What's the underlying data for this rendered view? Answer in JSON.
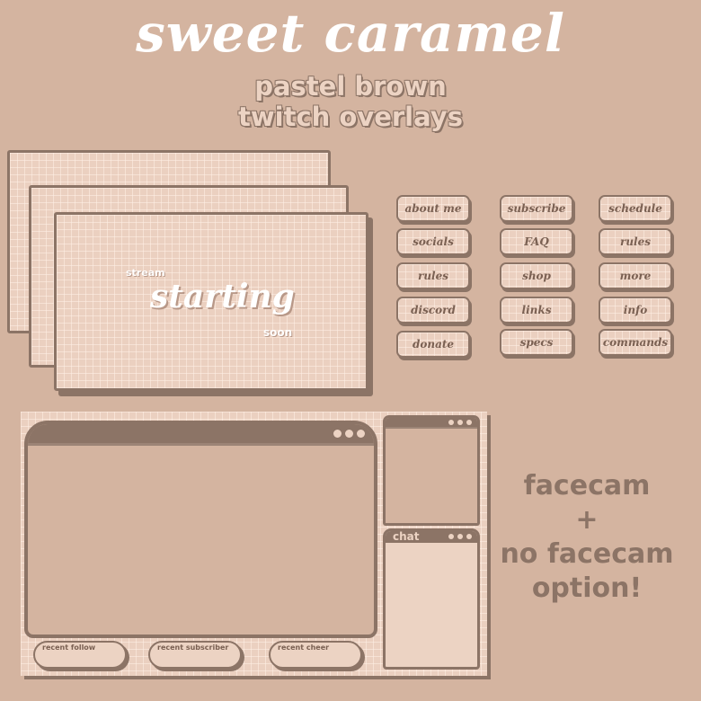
{
  "header": {
    "title": "sweet caramel",
    "subtitle_line1": "pastel brown",
    "subtitle_line2": "twitch overlays"
  },
  "screens": {
    "count": 3,
    "front_text": {
      "top": "stream",
      "main": "starting",
      "bottom": "soon"
    }
  },
  "panels": {
    "columns": [
      [
        "about me",
        "socials",
        "rules",
        "discord",
        "donate"
      ],
      [
        "subscribe",
        "FAQ",
        "shop",
        "links",
        "specs"
      ],
      [
        "schedule",
        "rules",
        "more",
        "info",
        "commands"
      ]
    ]
  },
  "overlay": {
    "main_window": {
      "icon": "window-dots-icon"
    },
    "cam_window": {
      "icon": "window-dots-icon"
    },
    "chat_window": {
      "label": "chat",
      "icon": "window-dots-icon"
    },
    "alerts": [
      "recent follow",
      "recent subscriber",
      "recent cheer"
    ]
  },
  "note": {
    "line1": "facecam",
    "line2": "+",
    "line3": "no facecam",
    "line4": "option!"
  },
  "colors": {
    "background": "#d4b4a0",
    "dark_brown": "#8c7466",
    "light_card": "#ebd0c0",
    "text_light": "#ecd3c3",
    "white": "#ffffff"
  }
}
